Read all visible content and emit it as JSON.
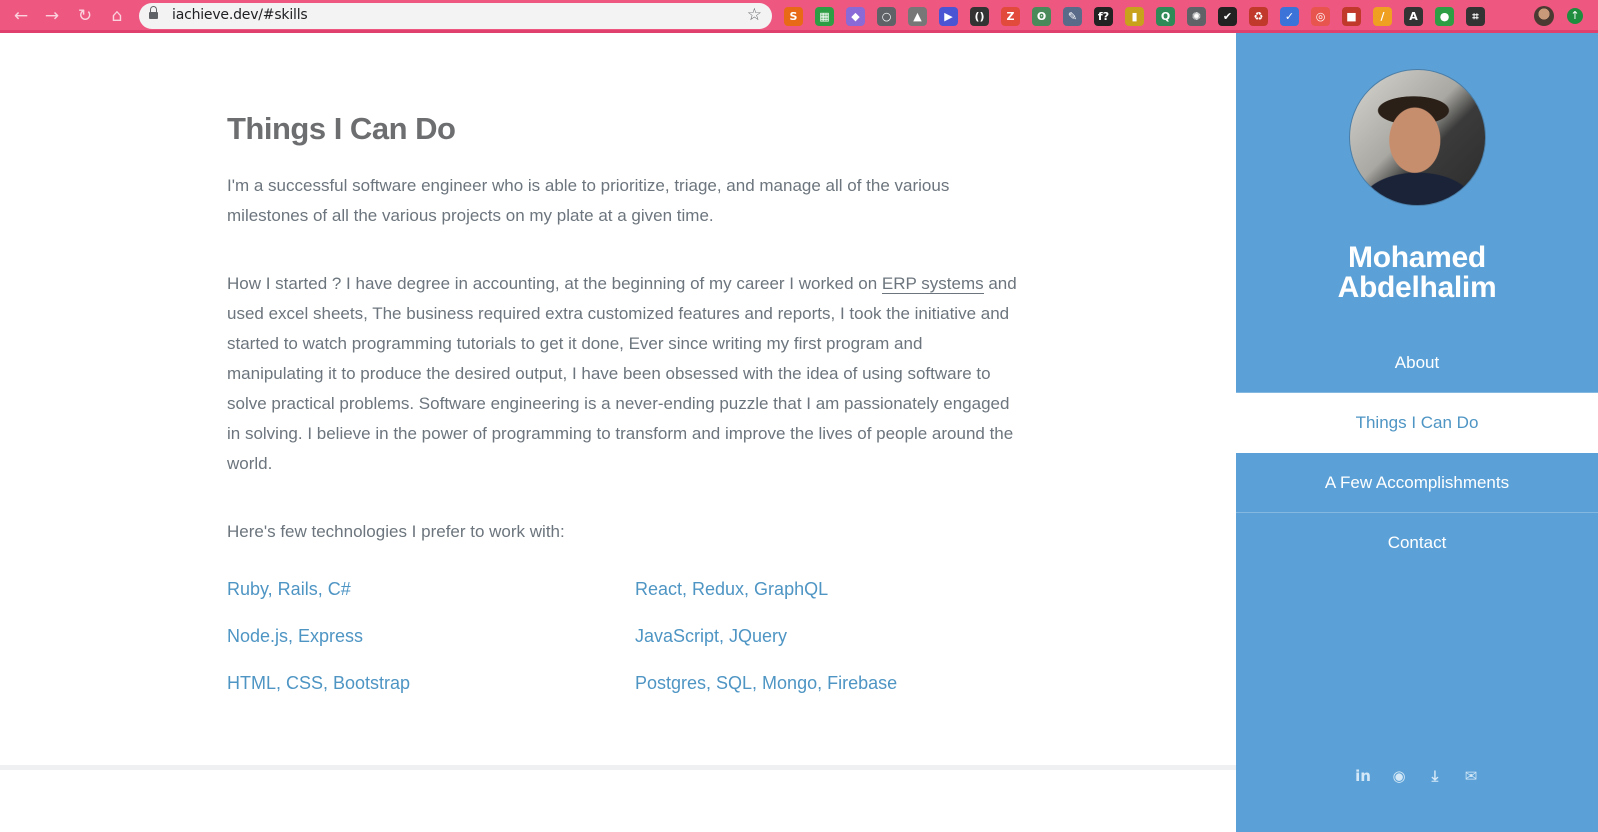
{
  "browser": {
    "url": "iachieve.dev/#skills",
    "nav": {
      "back": "←",
      "forward": "→",
      "reload": "↻",
      "home": "⌂"
    },
    "star": "☆",
    "extensions": [
      {
        "name": "s-extension-icon",
        "glyph": "S",
        "color": "#e86a17"
      },
      {
        "name": "printer-extension-icon",
        "glyph": "▦",
        "color": "#2e9e44"
      },
      {
        "name": "shield-extension-icon",
        "glyph": "◆",
        "color": "#8a6ad6"
      },
      {
        "name": "circle-extension-icon",
        "glyph": "○",
        "color": "#5f6368"
      },
      {
        "name": "triangle-extension-icon",
        "glyph": "▲",
        "color": "#777777"
      },
      {
        "name": "play-extension-icon",
        "glyph": "▶",
        "color": "#4a55d4"
      },
      {
        "name": "brackets-extension-icon",
        "glyph": "()",
        "color": "#333333"
      },
      {
        "name": "z-extension-icon",
        "glyph": "Z",
        "color": "#e24b3b"
      },
      {
        "name": "ear-extension-icon",
        "glyph": "ʘ",
        "color": "#4a8a5a"
      },
      {
        "name": "dropper-extension-icon",
        "glyph": "✎",
        "color": "#5a6b8a"
      },
      {
        "name": "f-extension-icon",
        "glyph": "f?",
        "color": "#222222"
      },
      {
        "name": "book-extension-icon",
        "glyph": "▮",
        "color": "#c8a21a"
      },
      {
        "name": "magnifier-extension-icon",
        "glyph": "Q",
        "color": "#2e8b57"
      },
      {
        "name": "react-extension-icon",
        "glyph": "✺",
        "color": "#5f6368"
      },
      {
        "name": "check-extension-icon",
        "glyph": "✔",
        "color": "#222222"
      },
      {
        "name": "recycle-extension-icon",
        "glyph": "♻",
        "color": "#c0392b"
      },
      {
        "name": "shield-blue-extension-icon",
        "glyph": "✓",
        "color": "#3b73d9"
      },
      {
        "name": "target-extension-icon",
        "glyph": "◎",
        "color": "#e8554e"
      },
      {
        "name": "bookmark-extension-icon",
        "glyph": "■",
        "color": "#c0392b"
      },
      {
        "name": "pen-extension-icon",
        "glyph": "/",
        "color": "#f0a020"
      },
      {
        "name": "a-circle-extension-icon",
        "glyph": "A",
        "color": "#333333"
      },
      {
        "name": "green-dot-extension-icon",
        "glyph": "●",
        "color": "#2e9e44"
      },
      {
        "name": "crop-extension-icon",
        "glyph": "⌗",
        "color": "#333333"
      }
    ],
    "update_glyph": "↑"
  },
  "main": {
    "heading": "Things I Can Do",
    "intro": "I'm a successful software engineer who is able to prioritize, triage, and manage all of the various milestones of all the various projects on my plate at a given time.",
    "story_before_link": "How I started ? I have degree in accounting, at the beginning of my career I worked on ",
    "story_link": "ERP systems",
    "story_after_link": " and used excel sheets, The business required extra customized features and reports, I took the initiative and started to watch programming tutorials to get it done, Ever since writing my first program and manipulating it to produce the desired output, I have been obsessed with the idea of using software to solve practical problems. Software engineering is a never-ending puzzle that I am passionately engaged in solving. I believe in the power of programming to transform and improve the lives of people around the world.",
    "tech_intro": "Here's few technologies I prefer to work with:",
    "technologies": [
      "Ruby, Rails, C#",
      "React, Redux, GraphQL",
      "Node.js, Express",
      "JavaScript, JQuery",
      "HTML, CSS, Bootstrap",
      "Postgres, SQL, Mongo, Firebase"
    ]
  },
  "sidebar": {
    "name_line1": "Mohamed",
    "name_line2": "Abdelhalim",
    "nav": [
      "About",
      "Things I Can Do",
      "A Few Accomplishments",
      "Contact"
    ],
    "active_nav": "Things I Can Do",
    "social": [
      {
        "name": "linkedin-icon",
        "glyph": "in"
      },
      {
        "name": "github-icon",
        "glyph": "◉"
      },
      {
        "name": "resume-download-icon",
        "glyph": "⤓"
      },
      {
        "name": "email-icon",
        "glyph": "✉"
      }
    ]
  },
  "colors": {
    "chrome": "#ee5780",
    "sidebar": "#5ba1d7",
    "link": "#4e95c4",
    "text": "#6c757d"
  }
}
